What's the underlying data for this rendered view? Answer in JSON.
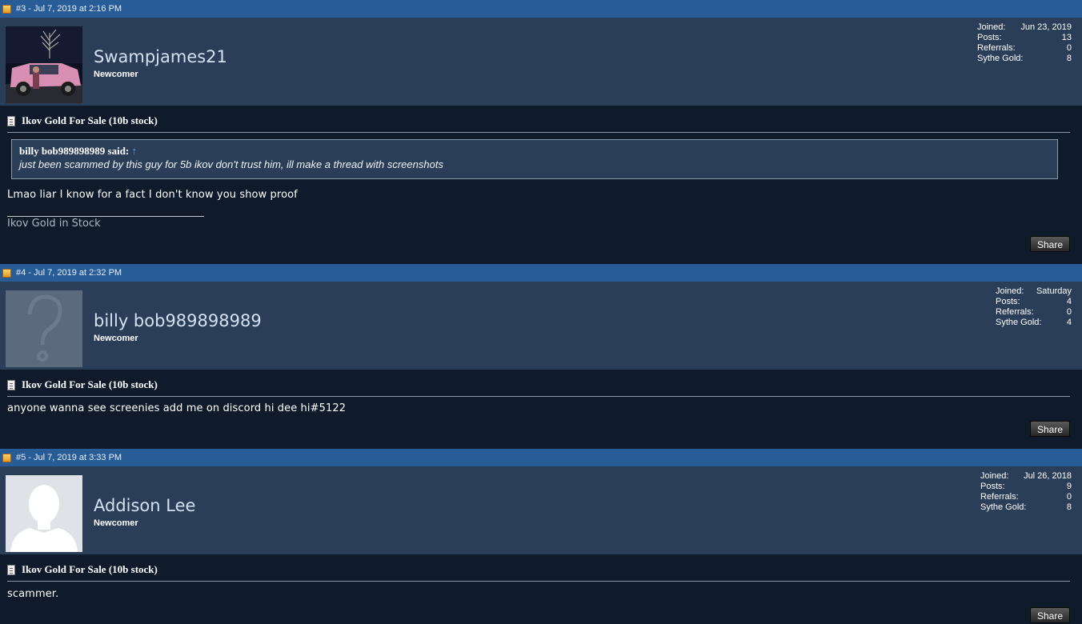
{
  "posts": [
    {
      "header": "#3 - Jul 7, 2019 at 2:16 PM",
      "username": "Swampjames21",
      "user_title": "Newcomer",
      "avatar": "photo-avatar",
      "stats": {
        "joined_label": "Joined:",
        "joined": "Jun 23, 2019",
        "posts_label": "Posts:",
        "posts": "13",
        "referrals_label": "Referrals:",
        "referrals": "0",
        "gold_label": "Sythe Gold:",
        "gold": "8"
      },
      "thread_title": "Ikov Gold For Sale (10b stock)",
      "quote": {
        "author": "billy bob989898989 said:",
        "arrow": "↑",
        "text": "just been scammed by this guy for 5b ikov don't trust him, ill make a thread with screenshots"
      },
      "message": "Lmao liar I know for a fact I don't know you show proof",
      "signature": "Ikov Gold in Stock",
      "share_label": "Share"
    },
    {
      "header": "#4 - Jul 7, 2019 at 2:32 PM",
      "username": "billy bob989898989",
      "user_title": "Newcomer",
      "avatar": "question-mark-avatar",
      "stats": {
        "joined_label": "Joined:",
        "joined": "Saturday",
        "posts_label": "Posts:",
        "posts": "4",
        "referrals_label": "Referrals:",
        "referrals": "0",
        "gold_label": "Sythe Gold:",
        "gold": "4"
      },
      "thread_title": "Ikov Gold For Sale (10b stock)",
      "message": "anyone wanna see screenies add me on discord hi dee hi#5122",
      "share_label": "Share"
    },
    {
      "header": "#5 - Jul 7, 2019 at 3:33 PM",
      "username": "Addison Lee",
      "user_title": "Newcomer",
      "avatar": "silhouette-avatar",
      "stats": {
        "joined_label": "Joined:",
        "joined": "Jul 26, 2018",
        "posts_label": "Posts:",
        "posts": "9",
        "referrals_label": "Referrals:",
        "referrals": "0",
        "gold_label": "Sythe Gold:",
        "gold": "8"
      },
      "thread_title": "Ikov Gold For Sale (10b stock)",
      "message": "scammer.",
      "share_label": "Share"
    }
  ],
  "colors": {
    "header_bar": "#285c96",
    "userbar": "#2b3e57",
    "body": "#0f1b2a",
    "username": "#d3e1f0"
  }
}
